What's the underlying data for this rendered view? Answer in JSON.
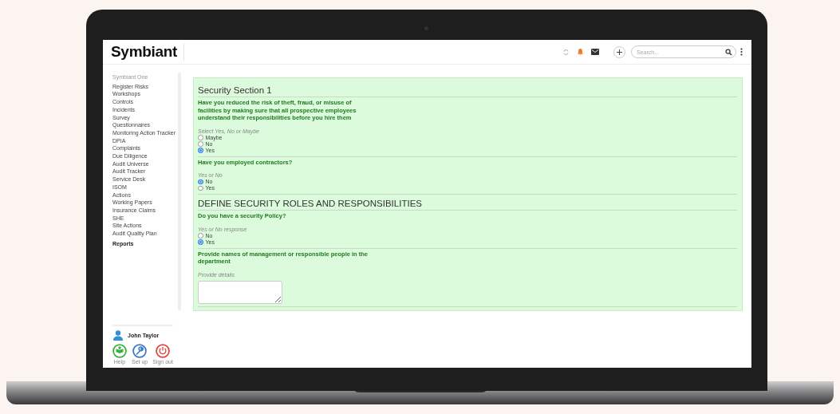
{
  "header": {
    "logo": "Symbiant",
    "search": {
      "placeholder": "Search..."
    }
  },
  "sidebar": {
    "items": [
      {
        "label": "Symbiant One",
        "kind": "heading"
      },
      {
        "label": "Register Risks",
        "kind": "item"
      },
      {
        "label": "Workshops",
        "kind": "item"
      },
      {
        "label": "Controls",
        "kind": "item"
      },
      {
        "label": "Incidents",
        "kind": "item"
      },
      {
        "label": "Survey",
        "kind": "item"
      },
      {
        "label": "Questionnaires",
        "kind": "item"
      },
      {
        "label": "Monitoring Action Tracker",
        "kind": "item"
      },
      {
        "label": "DPIA",
        "kind": "item"
      },
      {
        "label": "Complaints",
        "kind": "item"
      },
      {
        "label": "Due Diligence",
        "kind": "item"
      },
      {
        "label": "Audit Universe",
        "kind": "item"
      },
      {
        "label": "Audit Tracker",
        "kind": "item"
      },
      {
        "label": "Service Desk",
        "kind": "item"
      },
      {
        "label": "ISOM",
        "kind": "item"
      },
      {
        "label": "Actions",
        "kind": "item"
      },
      {
        "label": "Working Papers",
        "kind": "item"
      },
      {
        "label": "Insurance Claims",
        "kind": "item"
      },
      {
        "label": "SHE",
        "kind": "item"
      },
      {
        "label": "Site Actions",
        "kind": "item"
      },
      {
        "label": "Audit Quality Plan",
        "kind": "item"
      },
      {
        "label": "Reports",
        "kind": "bold"
      }
    ],
    "user": {
      "name": "John Taylor"
    },
    "actions": [
      {
        "label": "Help",
        "kind": "help",
        "color": "#3cb043"
      },
      {
        "label": "Set up",
        "kind": "setup",
        "color": "#3a78c9"
      },
      {
        "label": "Sign out",
        "kind": "signout",
        "color": "#e0473e"
      }
    ]
  },
  "form": {
    "sections": [
      {
        "title": "Security Section 1",
        "questions": [
          {
            "kind": "radio",
            "text": "Have you reduced the risk of theft, fraud, or misuse of facilities by making sure that all prospective employees understand their responsibilities before you hire them",
            "hint": "Select Yes, No or Maybe",
            "options": [
              {
                "label": "Maybe",
                "selected": false
              },
              {
                "label": "No",
                "selected": false
              },
              {
                "label": "Yes",
                "selected": true
              }
            ]
          },
          {
            "kind": "radio",
            "text": "Have you employed contractors?",
            "hint": "Yes or No",
            "options": [
              {
                "label": "No",
                "selected": true
              },
              {
                "label": "Yes",
                "selected": false
              }
            ]
          }
        ]
      },
      {
        "title": "DEFINE SECURITY ROLES AND RESPONSIBILITIES",
        "questions": [
          {
            "kind": "radio",
            "text": "Do you have a security Policy?",
            "hint": "Yes or No response",
            "options": [
              {
                "label": "No",
                "selected": false
              },
              {
                "label": "Yes",
                "selected": true
              }
            ]
          },
          {
            "kind": "text",
            "text": "Provide names of management or responsible people in the department",
            "hint": "Provide details"
          }
        ]
      }
    ]
  }
}
